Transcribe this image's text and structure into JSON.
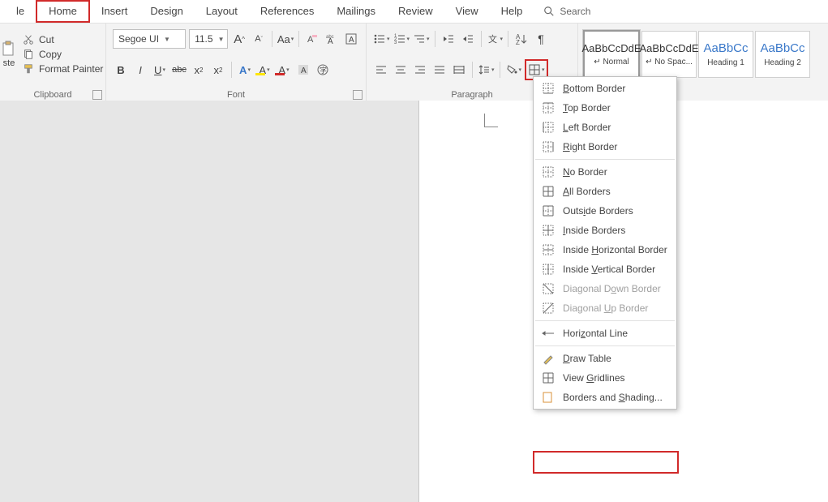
{
  "tabs": {
    "items": [
      "le",
      "Home",
      "Insert",
      "Design",
      "Layout",
      "References",
      "Mailings",
      "Review",
      "View",
      "Help"
    ],
    "search_label": "Search"
  },
  "clipboard": {
    "paste": "ste",
    "cut": "Cut",
    "copy": "Copy",
    "format_painter": "Format Painter",
    "group_label": "Clipboard"
  },
  "font": {
    "family": "Segoe UI",
    "size": "11.5",
    "inc_label": "A",
    "dec_label": "A",
    "case_label": "Aa",
    "bold": "B",
    "italic": "I",
    "underline": "U",
    "strike": "abc",
    "sub": "x",
    "sup": "x",
    "font_color_A": "A",
    "hilite_A": "A",
    "effects_A": "A",
    "group_label": "Font"
  },
  "paragraph": {
    "group_label": "Paragraph"
  },
  "styles": {
    "items": [
      {
        "preview": "AaBbCcDdE",
        "name": "↵ Normal",
        "blue": false
      },
      {
        "preview": "AaBbCcDdE",
        "name": "↵ No Spac...",
        "blue": false
      },
      {
        "preview": "AaBbCc",
        "name": "Heading 1",
        "blue": true
      },
      {
        "preview": "AaBbCc",
        "name": "Heading 2",
        "blue": true
      }
    ]
  },
  "borders_menu": {
    "items": [
      {
        "icon": "bottom",
        "label": "Bottom Border",
        "u": 0,
        "disabled": false
      },
      {
        "icon": "top",
        "label": "Top Border",
        "u": 0,
        "disabled": false
      },
      {
        "icon": "left",
        "label": "Left Border",
        "u": 0,
        "disabled": false
      },
      {
        "icon": "right",
        "label": "Right Border",
        "u": 0,
        "disabled": false
      },
      {
        "sep": true
      },
      {
        "icon": "none",
        "label": "No Border",
        "u": 0,
        "disabled": false
      },
      {
        "icon": "all",
        "label": "All Borders",
        "u": 0,
        "disabled": false
      },
      {
        "icon": "outside",
        "label": "Outside Borders",
        "u": 4,
        "disabled": false
      },
      {
        "icon": "inside",
        "label": "Inside Borders",
        "u": 0,
        "disabled": false
      },
      {
        "icon": "insideh",
        "label": "Inside Horizontal Border",
        "u": 7,
        "disabled": false
      },
      {
        "icon": "insidev",
        "label": "Inside Vertical Border",
        "u": 7,
        "disabled": false
      },
      {
        "icon": "diagdown",
        "label": "Diagonal Down Border",
        "u": 10,
        "disabled": true
      },
      {
        "icon": "diagup",
        "label": "Diagonal Up Border",
        "u": 9,
        "disabled": true
      },
      {
        "sep": true
      },
      {
        "icon": "hline",
        "label": "Horizontal Line",
        "u": 4,
        "disabled": false
      },
      {
        "sep": true
      },
      {
        "icon": "draw",
        "label": "Draw Table",
        "u": 0,
        "disabled": false
      },
      {
        "icon": "grid",
        "label": "View Gridlines",
        "u": 5,
        "disabled": false
      },
      {
        "icon": "shading",
        "label": "Borders and Shading...",
        "u": 12,
        "disabled": false
      }
    ]
  }
}
